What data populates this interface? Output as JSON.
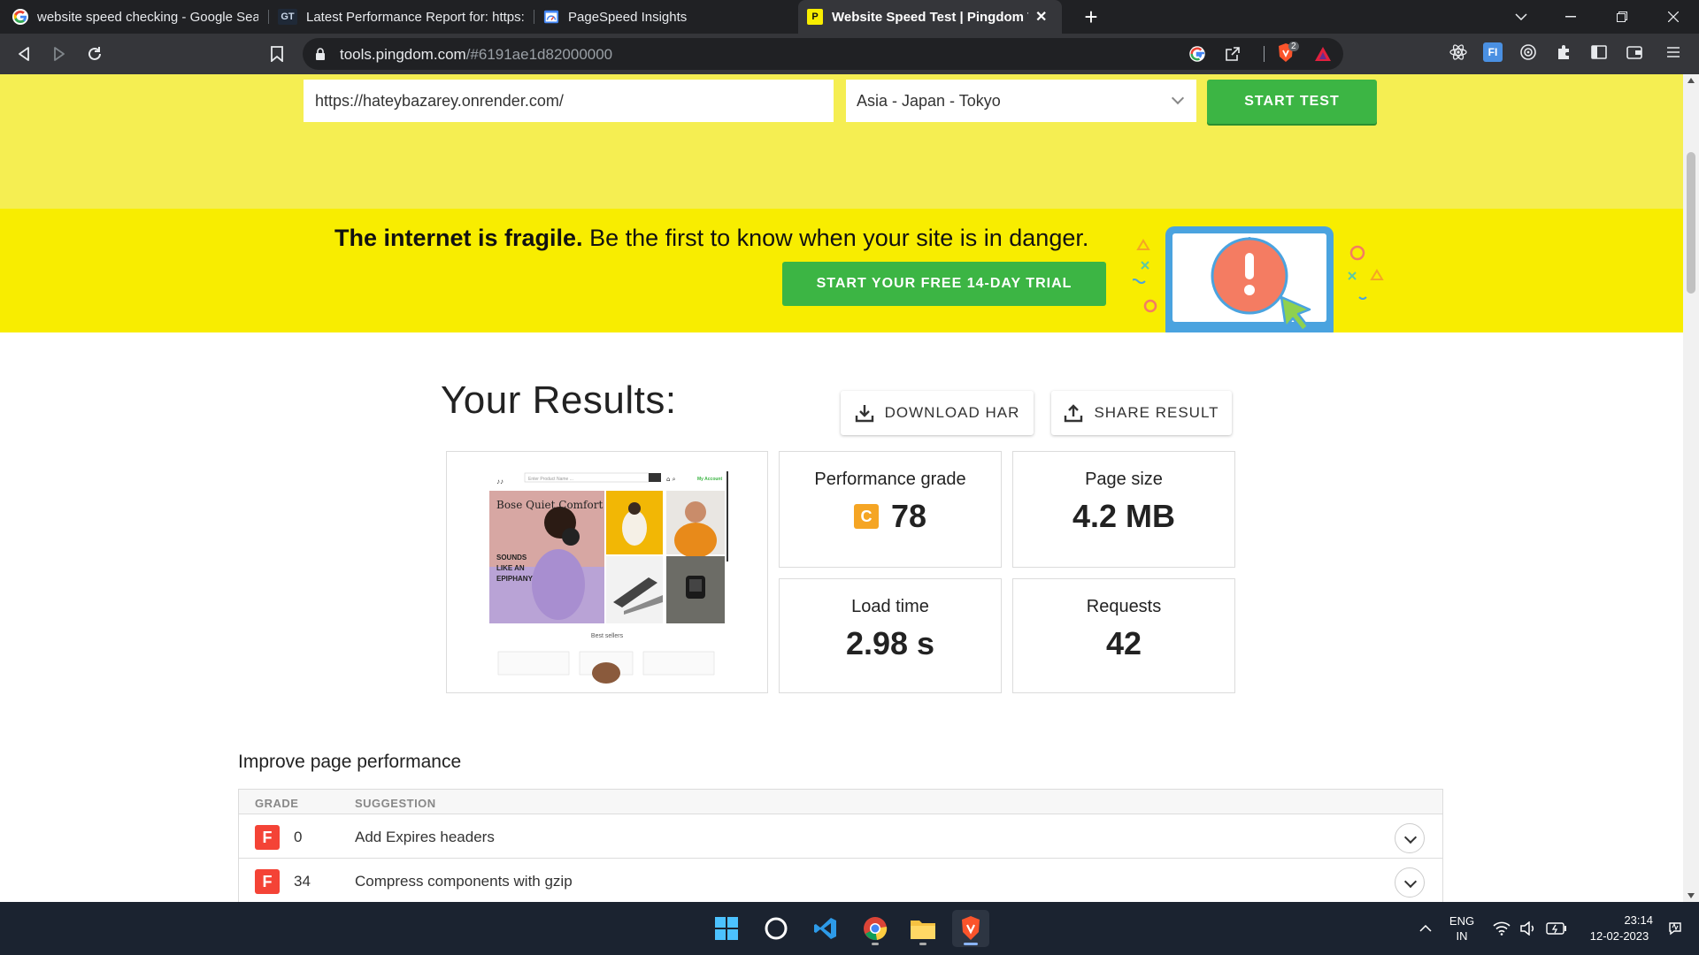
{
  "browser": {
    "tabs": [
      {
        "title": "website speed checking - Google Sear",
        "icon": "google-icon"
      },
      {
        "title": "Latest Performance Report for: https://",
        "icon": "gtmetrix-icon"
      },
      {
        "title": "PageSpeed Insights",
        "icon": "pagespeed-icon"
      },
      {
        "title": "Website Speed Test | Pingdom To",
        "icon": "pingdom-icon",
        "active": true
      }
    ],
    "url_domain": "tools.pingdom.com",
    "url_path": "/#6191ae1d82000000",
    "brave_badge": "2"
  },
  "test_form": {
    "url_value": "https://hateybazarey.onrender.com/",
    "location": "Asia - Japan - Tokyo",
    "start_label": "START TEST"
  },
  "promo": {
    "bold": "The internet is fragile.",
    "rest": " Be the first to know when your site is in danger.",
    "trial_label": "START YOUR FREE 14-DAY TRIAL"
  },
  "results": {
    "title": "Your Results:",
    "download_label": "DOWNLOAD HAR",
    "share_label": "SHARE RESULT",
    "performance": {
      "label": "Performance grade",
      "grade": "C",
      "score": "78"
    },
    "page_size": {
      "label": "Page size",
      "value": "4.2 MB"
    },
    "load_time": {
      "label": "Load time",
      "value": "2.98 s"
    },
    "requests": {
      "label": "Requests",
      "value": "42"
    }
  },
  "thumbnail": {
    "search_placeholder": "Enter Product Name ...",
    "account": "My Account",
    "hero_title": "Bose Quiet Comfort",
    "hero_sub": "SOUNDS LIKE AN EPIPHANY",
    "best_sellers": "Best sellers"
  },
  "improve": {
    "title": "Improve page performance",
    "col_grade": "GRADE",
    "col_suggestion": "SUGGESTION",
    "rows": [
      {
        "grade": "F",
        "score": "0",
        "text": "Add Expires headers"
      },
      {
        "grade": "F",
        "score": "34",
        "text": "Compress components with gzip"
      }
    ]
  },
  "taskbar": {
    "lang1": "ENG",
    "lang2": "IN",
    "time": "23:14",
    "date": "12-02-2023"
  },
  "colors": {
    "accent_green": "#3cb544",
    "promo_yellow": "#f8ed00",
    "form_yellow": "#f5ee52",
    "grade_c": "#f5a524",
    "grade_f": "#f44336"
  }
}
